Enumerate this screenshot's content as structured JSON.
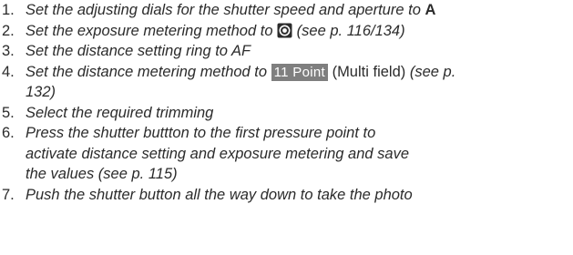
{
  "steps": [
    {
      "num": "1.",
      "parts": {
        "a": "Set the adjusting dials for the shutter speed and aperture to ",
        "b": "A"
      }
    },
    {
      "num": "2.",
      "parts": {
        "a": "Set the exposure metering method to ",
        "b": " (see p. 116/134)"
      }
    },
    {
      "num": "3.",
      "parts": {
        "a": "Set the distance setting ring to AF"
      }
    },
    {
      "num": "4.",
      "parts": {
        "a": "Set the distance metering method to ",
        "badge": "11 Point",
        "b": " (Multi field)",
        "c": " (see p.",
        "d": "132)"
      }
    },
    {
      "num": "5.",
      "parts": {
        "a": "Select the required trimming"
      }
    },
    {
      "num": "6.",
      "parts": {
        "a": "Press the shutter buttton to the first pressure point to",
        "b": "activate distance setting and exposure metering and save",
        "c": "the values (see p. 115)"
      }
    },
    {
      "num": "7.",
      "parts": {
        "a": "Push the shutter button all the way down to take the photo"
      }
    }
  ],
  "icons": {
    "step2": "spot-metering-icon"
  },
  "colors": {
    "text": "#2b2b2b",
    "badge_bg": "#7f7f7f",
    "badge_text": "#ffffff"
  }
}
